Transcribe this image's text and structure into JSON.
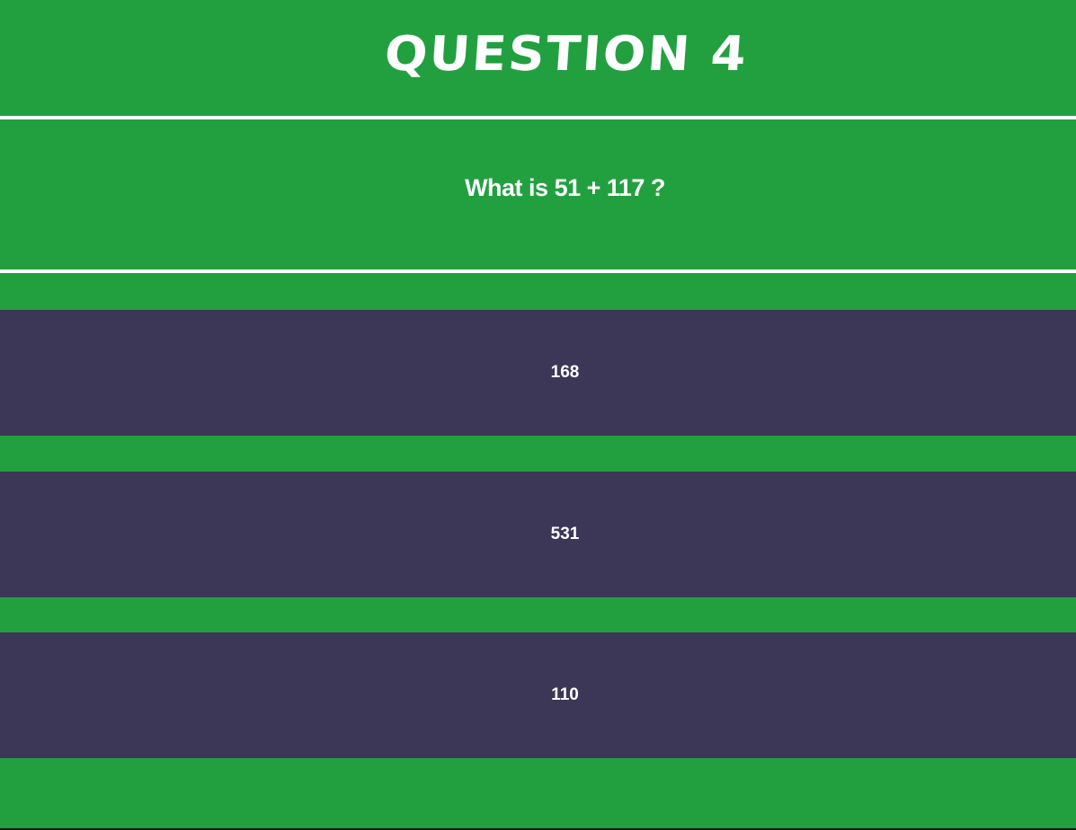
{
  "header": {
    "title": "QUESTION 4"
  },
  "question": {
    "text": "What is 51 + 117 ?"
  },
  "answers": [
    {
      "label": "168"
    },
    {
      "label": "531"
    },
    {
      "label": "110"
    }
  ],
  "colors": {
    "background": "#22a040",
    "answer_background": "#3c3757",
    "text": "#ffffff"
  }
}
